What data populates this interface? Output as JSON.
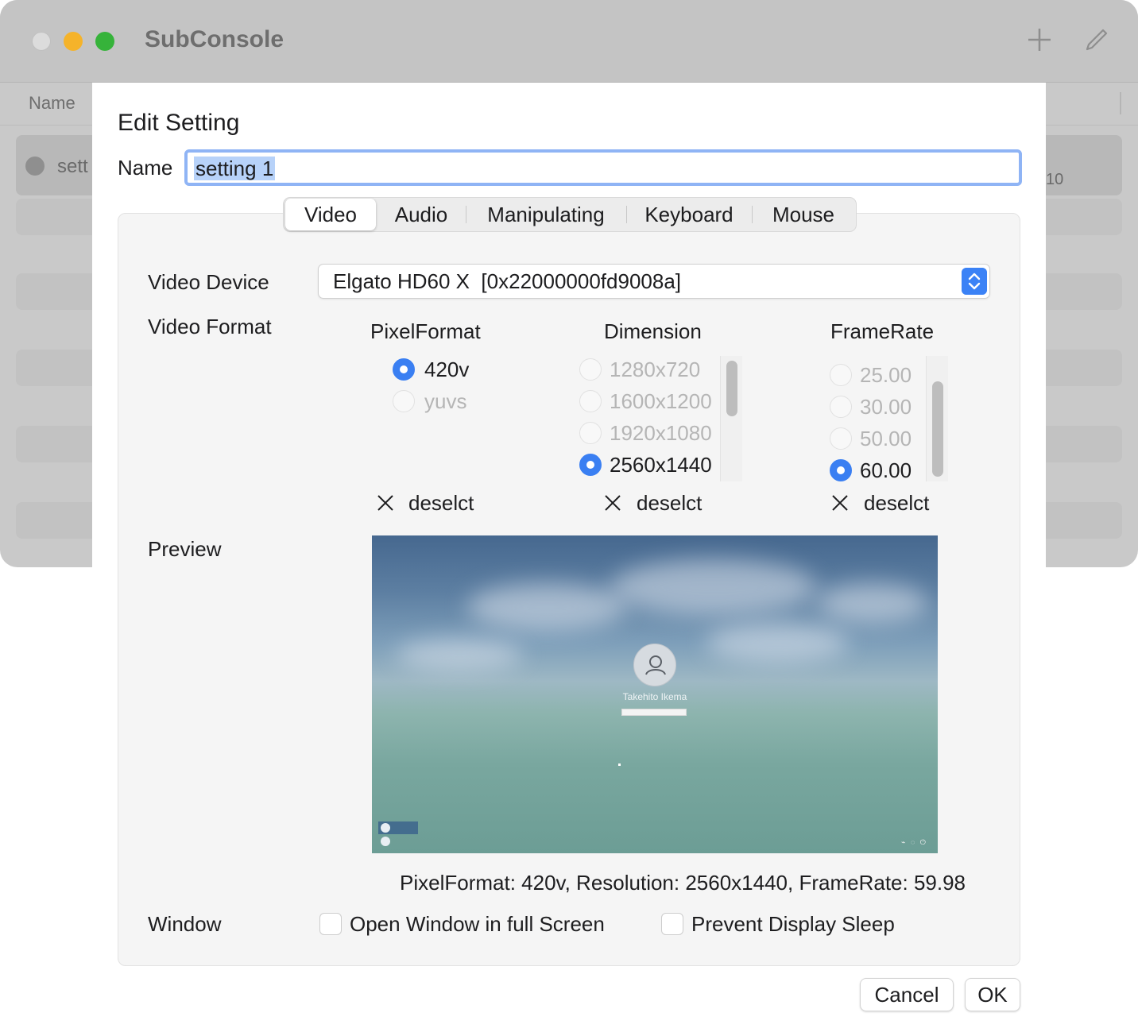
{
  "app": {
    "title": "SubConsole"
  },
  "list": {
    "column_name": "Name",
    "rows": [
      {
        "label": "sett",
        "count": "10"
      }
    ]
  },
  "sheet": {
    "title": "Edit Setting",
    "name_label": "Name",
    "name_value": "setting 1"
  },
  "tabs": [
    "Video",
    "Audio",
    "Manipulating",
    "Keyboard",
    "Mouse"
  ],
  "video": {
    "device_label": "Video Device",
    "device_value": "Elgato HD60 X  [0x22000000fd9008a]",
    "format_label": "Video Format",
    "pixel_format": {
      "header": "PixelFormat",
      "options": [
        {
          "label": "420v",
          "selected": true,
          "enabled": true
        },
        {
          "label": "yuvs",
          "selected": false,
          "enabled": false
        }
      ],
      "deselect_label": "deselct"
    },
    "dimension": {
      "header": "Dimension",
      "options": [
        {
          "label": "1280x720",
          "selected": false,
          "enabled": false
        },
        {
          "label": "1600x1200",
          "selected": false,
          "enabled": false
        },
        {
          "label": "1920x1080",
          "selected": false,
          "enabled": false
        },
        {
          "label": "2560x1440",
          "selected": true,
          "enabled": true
        }
      ],
      "deselect_label": "deselct"
    },
    "frame_rate": {
      "header": "FrameRate",
      "options": [
        {
          "label": "25.00",
          "selected": false,
          "enabled": false
        },
        {
          "label": "30.00",
          "selected": false,
          "enabled": false
        },
        {
          "label": "50.00",
          "selected": false,
          "enabled": false
        },
        {
          "label": "60.00",
          "selected": true,
          "enabled": true
        }
      ],
      "deselect_label": "deselct"
    },
    "preview_label": "Preview",
    "preview_user_name": "Takehito Ikema",
    "status": "PixelFormat: 420v, Resolution: 2560x1440, FrameRate: 59.98",
    "window_label": "Window",
    "checkboxes": [
      {
        "label": "Open Window in full Screen",
        "checked": false
      },
      {
        "label": "Prevent Display Sleep",
        "checked": false
      }
    ]
  },
  "buttons": {
    "cancel": "Cancel",
    "ok": "OK"
  },
  "colors": {
    "accent": "#3a7ff2",
    "selection": "#b7d2f9",
    "focus_ring": "#8fb4f5"
  },
  "icons": {
    "add": "plus-icon",
    "edit": "pencil-icon",
    "deselect": "x-icon",
    "stepper": "chevron-updown-icon"
  }
}
